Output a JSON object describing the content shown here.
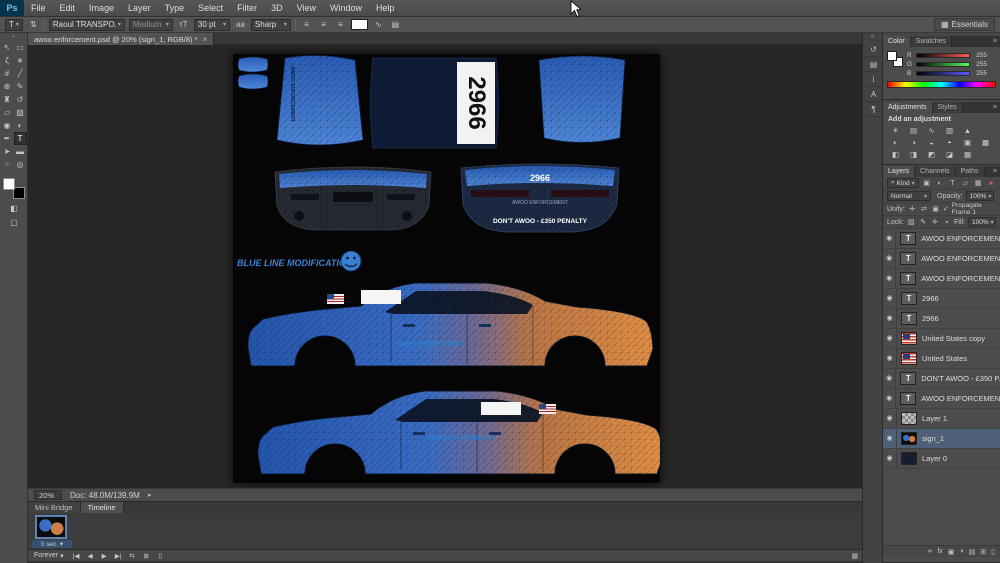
{
  "menubar": {
    "logo": "Ps",
    "items": [
      "File",
      "Edit",
      "Image",
      "Layer",
      "Type",
      "Select",
      "Filter",
      "3D",
      "View",
      "Window",
      "Help"
    ]
  },
  "optionsbar": {
    "tool_glyph": "T",
    "orientation_glyph": "⇅",
    "font_value": "Raoul TRANSPO...",
    "style_value": "Medium",
    "size_glyph": "тT",
    "size_value": "30 pt",
    "aa_glyph": "aa",
    "aa_value": "Sharp",
    "align_left_glyph": "≡",
    "align_center_glyph": "≡",
    "align_right_glyph": "≡",
    "swatch_color": "#ffffff",
    "warp_glyph": "∿",
    "panels_glyph": "▤",
    "workspace_icon": "▦",
    "workspace_label": "Essentials",
    "dropdown_glyph": "▾"
  },
  "tabbar": {
    "title": "awoo enforcement.psd @ 20% (sign_1, RGB/8) *",
    "close_glyph": "×"
  },
  "toolbar": {
    "collapse_glyph": "«",
    "quickmask_glyph": "◧",
    "screenmode_glyph": "▢",
    "tools": [
      {
        "name": "move",
        "glyph": "↖"
      },
      {
        "name": "rectangular-marquee",
        "glyph": "▭"
      },
      {
        "name": "lasso",
        "glyph": "ζ"
      },
      {
        "name": "quick-selection",
        "glyph": "∗"
      },
      {
        "name": "crop",
        "glyph": "#"
      },
      {
        "name": "eyedropper",
        "glyph": "╱"
      },
      {
        "name": "spot-healing",
        "glyph": "⊕"
      },
      {
        "name": "brush",
        "glyph": "✎"
      },
      {
        "name": "clone-stamp",
        "glyph": "♜"
      },
      {
        "name": "history-brush",
        "glyph": "↺"
      },
      {
        "name": "eraser",
        "glyph": "▱"
      },
      {
        "name": "gradient",
        "glyph": "▧"
      },
      {
        "name": "blur",
        "glyph": "◉"
      },
      {
        "name": "dodge",
        "glyph": "◐"
      },
      {
        "name": "pen",
        "glyph": "✒"
      },
      {
        "name": "horizontal-type",
        "glyph": "T"
      },
      {
        "name": "path-selection",
        "glyph": "➤"
      },
      {
        "name": "rectangle",
        "glyph": "▬"
      },
      {
        "name": "hand",
        "glyph": "☞"
      },
      {
        "name": "zoom",
        "glyph": "◎"
      }
    ]
  },
  "canvas": {
    "hood_text": "AWOO ENFORCEMENT",
    "roof_number": "2966",
    "rear_number": "2966",
    "rear_brand": "AWOO ENFORCEMENT",
    "rear_warning": "DON'T AWOO - £350 PENALTY",
    "logo_text": "BLUE LINE MODIFICATIONS",
    "side_a_text": "AWOO ENFORCEMENT",
    "side_b_text": "AWOO ENFORCEMENT",
    "gradient_blue": "#2e63bd",
    "gradient_orange": "#d9853f"
  },
  "statusbar": {
    "zoom": "20%",
    "doc_info": "Doc: 48.0M/139.9M",
    "arrow_glyph": "▸"
  },
  "timeline": {
    "tabs": [
      "Mini Bridge",
      "Timeline"
    ],
    "frame_duration": "0 sec. ▾",
    "loop_label": "Forever",
    "loop_arrow": "▾",
    "controls": {
      "first_frame": "|◀",
      "prev_frame": "◀",
      "play": "▶",
      "next_frame": "▶|",
      "tween": "⇆",
      "new_frame": "⊞",
      "delete_frame": "▯"
    },
    "convert_glyph": "▦"
  },
  "dock": {
    "collapse_glyph": "«",
    "icons": [
      {
        "name": "history",
        "glyph": "↺"
      },
      {
        "name": "properties",
        "glyph": "▤"
      },
      {
        "name": "info",
        "glyph": "i"
      },
      {
        "name": "character",
        "glyph": "A"
      },
      {
        "name": "paragraph",
        "glyph": "¶"
      }
    ]
  },
  "color_panel": {
    "tabs": [
      "Color",
      "Swatches"
    ],
    "menu_glyph": "≡",
    "channels": [
      {
        "label": "R",
        "value": "255"
      },
      {
        "label": "G",
        "value": "255"
      },
      {
        "label": "B",
        "value": "255"
      }
    ]
  },
  "adjustments_panel": {
    "tabs": [
      "Adjustments",
      "Styles"
    ],
    "menu_glyph": "≡",
    "title": "Add an adjustment",
    "icons": [
      "☀",
      "▤",
      "∿",
      "▧",
      "▲",
      "◐",
      "◑",
      "◒",
      "◓",
      "▣",
      "▩",
      "◧",
      "◨",
      "◩",
      "◪",
      "▦"
    ]
  },
  "layers_panel": {
    "tabs": [
      "Layers",
      "Channels",
      "Paths"
    ],
    "menu_glyph": "≡",
    "search_glyph": "⌕",
    "kind_value": "Kind",
    "dropdown_glyph": "▾",
    "filter_icons": [
      "▣",
      "◐",
      "T",
      "▱",
      "▦"
    ],
    "filter_toggle_glyph": "●",
    "blend_value": "Normal",
    "opacity_label": "Opacity:",
    "opacity_value": "100%",
    "unify_label": "Unify:",
    "unify_icons": [
      "✛",
      "⇄",
      "▣"
    ],
    "propagate_check": "✓",
    "propagate_label": "Propagate Frame 1",
    "lock_label": "Lock:",
    "lock_icons": [
      "▨",
      "✎",
      "✛",
      "▪"
    ],
    "fill_label": "Fill:",
    "fill_value": "100%",
    "eye_glyph": "◉",
    "text_icon": "T",
    "layers": [
      {
        "kind": "text",
        "name": "AWOO ENFORCEMENT"
      },
      {
        "kind": "text",
        "name": "AWOO ENFORCEMENT"
      },
      {
        "kind": "text",
        "name": "AWOO ENFORCEMENT"
      },
      {
        "kind": "text",
        "name": "2966"
      },
      {
        "kind": "text",
        "name": "2966"
      },
      {
        "kind": "flag",
        "name": "United States copy"
      },
      {
        "kind": "flag",
        "name": "United States"
      },
      {
        "kind": "text",
        "name": "DON'T AWOO - £350 P..."
      },
      {
        "kind": "text",
        "name": "AWOO ENFORCEMENT"
      },
      {
        "kind": "checker",
        "name": "Layer 1"
      },
      {
        "kind": "texture",
        "name": "sign_1"
      },
      {
        "kind": "dark",
        "name": "Layer 0"
      }
    ],
    "footer_icons": [
      {
        "name": "link-layers",
        "glyph": "∞"
      },
      {
        "name": "layer-effects",
        "glyph": "fx"
      },
      {
        "name": "layer-mask",
        "glyph": "▣"
      },
      {
        "name": "adjustment-layer",
        "glyph": "◑"
      },
      {
        "name": "layer-group",
        "glyph": "▤"
      },
      {
        "name": "new-layer",
        "glyph": "⊞"
      },
      {
        "name": "delete-layer",
        "glyph": "▯"
      }
    ]
  }
}
